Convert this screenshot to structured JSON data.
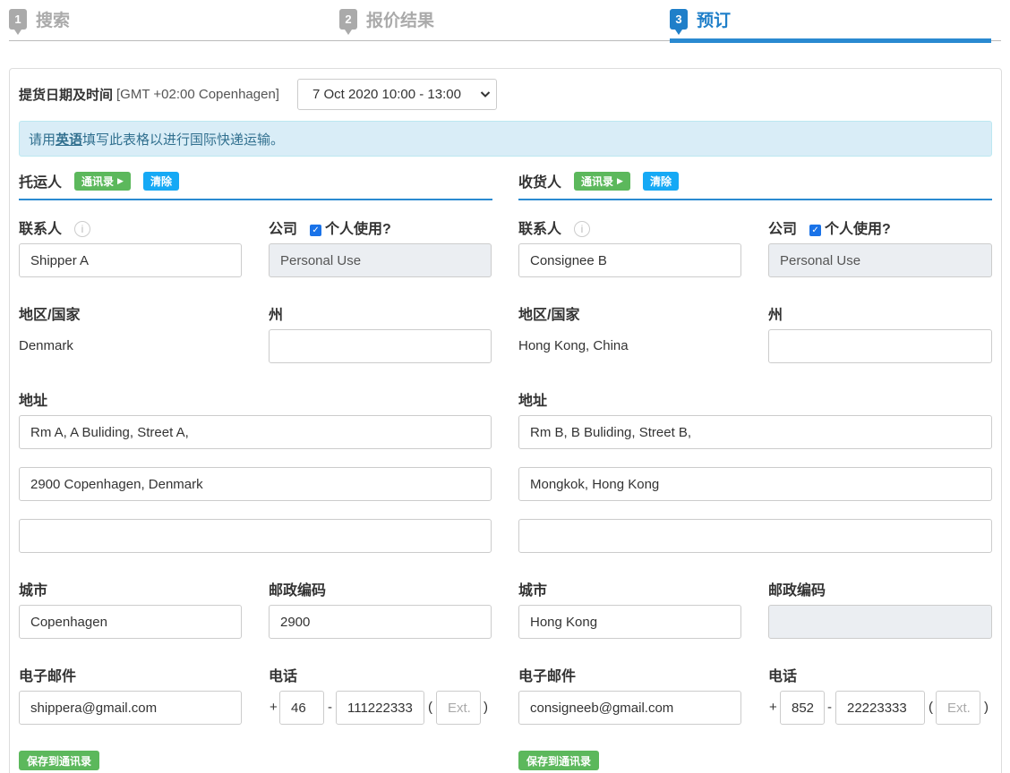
{
  "steps": [
    {
      "num": "1",
      "label": "搜索"
    },
    {
      "num": "2",
      "label": "报价结果"
    },
    {
      "num": "3",
      "label": "预订"
    }
  ],
  "pickup": {
    "label": "提货日期及时间",
    "timezone": "[GMT +02:00 Copenhagen]",
    "selected": "7 Oct 2020 10:00 - 13:00"
  },
  "notice": {
    "prefix": "请用",
    "highlight": "英语",
    "suffix": "填写此表格以进行国际快递运输。"
  },
  "shipper": {
    "title": "托运人",
    "address_book_btn": "通讯录",
    "clear_btn": "清除",
    "contact_label": "联系人",
    "contact_value": "Shipper A",
    "company_label": "公司",
    "personal_use_label": "个人使用?",
    "company_value": "Personal Use",
    "country_label": "地区/国家",
    "country_value": "Denmark",
    "state_label": "州",
    "state_value": "",
    "address_label": "地址",
    "address1": "Rm A, A Buliding, Street A,",
    "address2": "2900 Copenhagen, Denmark",
    "address3": "",
    "city_label": "城市",
    "city_value": "Copenhagen",
    "zip_label": "邮政编码",
    "zip_value": "2900",
    "email_label": "电子邮件",
    "email_value": "shippera@gmail.com",
    "phone_label": "电话",
    "phone_country": "46",
    "phone_number": "111222333",
    "ext_placeholder": "Ext.",
    "save_btn": "保存到通讯录"
  },
  "consignee": {
    "title": "收货人",
    "address_book_btn": "通讯录",
    "clear_btn": "清除",
    "contact_label": "联系人",
    "contact_value": "Consignee B",
    "company_label": "公司",
    "personal_use_label": "个人使用?",
    "company_value": "Personal Use",
    "country_label": "地区/国家",
    "country_value": "Hong Kong, China",
    "state_label": "州",
    "state_value": "",
    "address_label": "地址",
    "address1": "Rm B, B Buliding, Street B,",
    "address2": "Mongkok, Hong Kong",
    "address3": "",
    "city_label": "城市",
    "city_value": "Hong Kong",
    "zip_label": "邮政编码",
    "zip_value": "",
    "email_label": "电子邮件",
    "email_value": "consigneeb@gmail.com",
    "phone_label": "电话",
    "phone_country": "852",
    "phone_number": "22223333",
    "ext_placeholder": "Ext.",
    "save_btn": "保存到通讯录"
  },
  "symbols": {
    "plus": "+",
    "dash": "-",
    "lparen": "(",
    "rparen": ")"
  },
  "colors": {
    "accent": "#2a8ad1",
    "green": "#5cb85c",
    "blue_btn": "#16a9f5",
    "notice_bg": "#d9edf7"
  }
}
